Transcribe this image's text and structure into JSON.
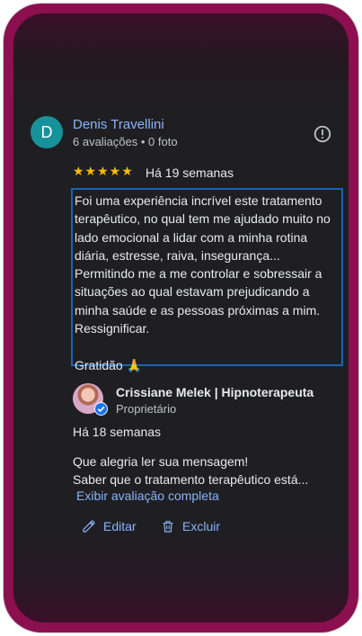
{
  "review": {
    "avatar_letter": "D",
    "reviewer_name": "Denis Travellini",
    "reviewer_meta": "6 avaliações • 0 foto",
    "stars": "★★★★★",
    "rating": 5,
    "date": "Há 19 semanas",
    "text": "Foi uma experiência incrível este tratamento terapêutico, no qual tem me ajudado muito no lado emocional a lidar com a minha rotina diária, estresse, raiva, insegurança... Permitindo me a me controlar e sobressair a situações ao qual estavam prejudicando a minha saúde e as pessoas próximas a mim.\nRessignificar.\n\nGratidão 🙏"
  },
  "owner_response": {
    "name": "Crissiane Melek | Hipnoterapeuta",
    "role": "Proprietário",
    "date": "Há 18 semanas",
    "text": "Que alegria ler sua mensagem!\nSaber que o tratamento terapêutico está...",
    "expand_label": "Exibir avaliação completa"
  },
  "actions": {
    "edit_label": "Editar",
    "delete_label": "Excluir"
  },
  "colors": {
    "accent": "#8ab4f8",
    "star": "#fbbc04",
    "frame": "#8c0f4f",
    "avatar": "#18929a",
    "focus_border": "#1a64b4"
  }
}
